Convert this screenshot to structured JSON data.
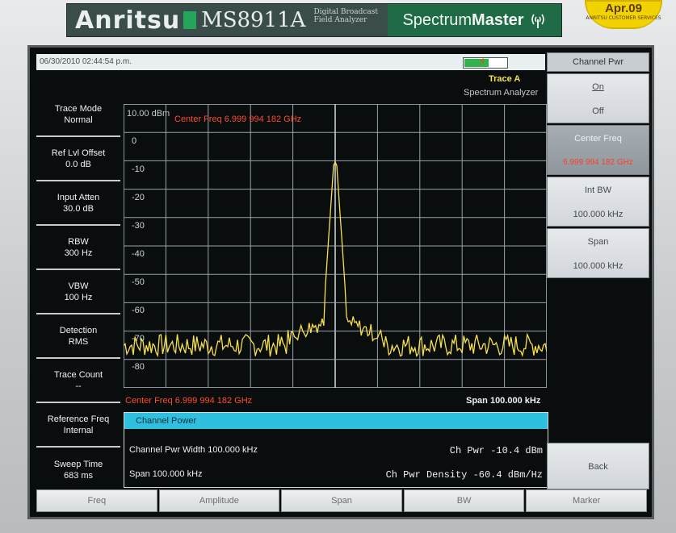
{
  "device": {
    "brand": "Anritsu",
    "model": "MS8911A",
    "model_sub": "Digital Broadcast Field Analyzer",
    "series": "Spectrum",
    "series_bold": "Master",
    "sticker": "Apr.09",
    "sticker_sub": "ANRITSU CUSTOMER SERVICES"
  },
  "status": {
    "datetime": "06/30/2010 02:44:54 p.m.",
    "trace": "Trace A",
    "mode": "Spectrum Analyzer"
  },
  "left_menu": [
    {
      "l1": "Trace Mode",
      "l2": "Normal"
    },
    {
      "l1": "Ref Lvl Offset",
      "l2": "0.0 dB"
    },
    {
      "l1": "Input Atten",
      "l2": "30.0 dB"
    },
    {
      "l1": "RBW",
      "l2": "300 Hz"
    },
    {
      "l1": "VBW",
      "l2": "100 Hz"
    },
    {
      "l1": "Detection",
      "l2": "RMS"
    },
    {
      "l1": "Trace Count",
      "l2": "--"
    },
    {
      "l1": "Reference Freq",
      "l2": "Internal"
    },
    {
      "l1": "Sweep Time",
      "l2": "683 ms"
    }
  ],
  "graph": {
    "ref_level": "10.00 dBm",
    "center_freq_label": "Center Freq 6.999 994 182 GHz",
    "y_ticks": [
      "0",
      "-10",
      "-20",
      "-30",
      "-40",
      "-50",
      "-60",
      "-70",
      "-80"
    ],
    "bottom_center": "Center Freq 6.999 994 182 GHz",
    "bottom_span": "Span 100.000 kHz"
  },
  "channel_power": {
    "title": "Channel Power",
    "width_label": "Channel Pwr Width 100.000 kHz",
    "span_label": "Span 100.000 kHz",
    "ch_pwr": "Ch Pwr  -10.4 dBm",
    "ch_density": "Ch Pwr Density  -60.4 dBm/Hz"
  },
  "right_menu": {
    "title": "Channel Pwr",
    "on": "On",
    "off": "Off",
    "center_label": "Center Freq",
    "center_value": "6.999 994 182 GHz",
    "int_bw_label": "Int BW",
    "int_bw_value": "100.000 kHz",
    "span_label": "Span",
    "span_value": "100.000 kHz",
    "back": "Back"
  },
  "tabs": [
    "Freq",
    "Amplitude",
    "Span",
    "BW",
    "Marker"
  ],
  "colors": {
    "trace": "#f7e14a",
    "grid": "#9aa2a8",
    "annotation": "#ff4a2a",
    "header": "#2fc0e0"
  }
}
